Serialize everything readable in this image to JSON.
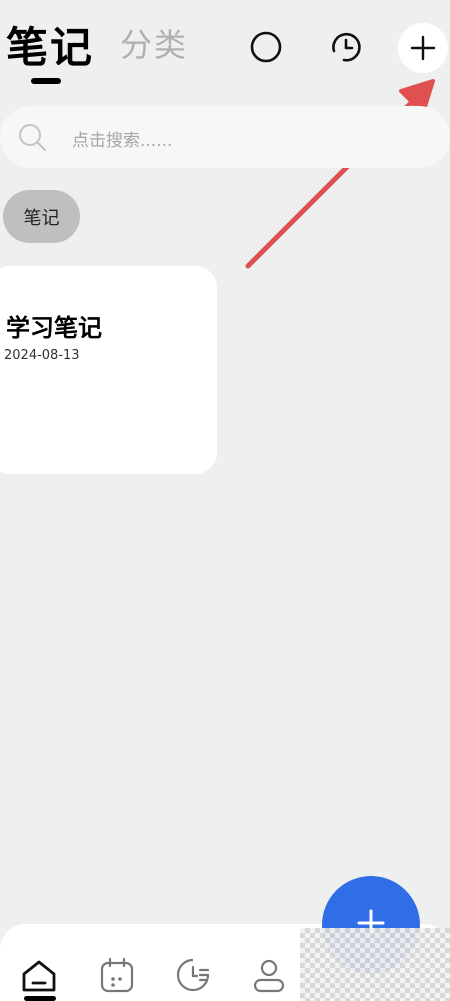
{
  "header": {
    "tabs": [
      {
        "label": "笔记",
        "active": true
      },
      {
        "label": "分类",
        "active": false
      }
    ],
    "icons": [
      "circle-icon",
      "clock-icon",
      "plus-icon"
    ]
  },
  "search": {
    "placeholder": "点击搜索......"
  },
  "category_chip": {
    "label": "笔记"
  },
  "notes": [
    {
      "title": "学习笔记",
      "date": "2024-08-13"
    }
  ],
  "fab": {
    "icon": "plus-icon"
  },
  "bottom_nav": {
    "items": [
      "home-icon",
      "calendar-icon",
      "stats-icon",
      "profile-icon"
    ]
  },
  "colors": {
    "background": "#eef0ef",
    "accent": "#2f6ee6",
    "annotation_arrow": "#e05050"
  }
}
